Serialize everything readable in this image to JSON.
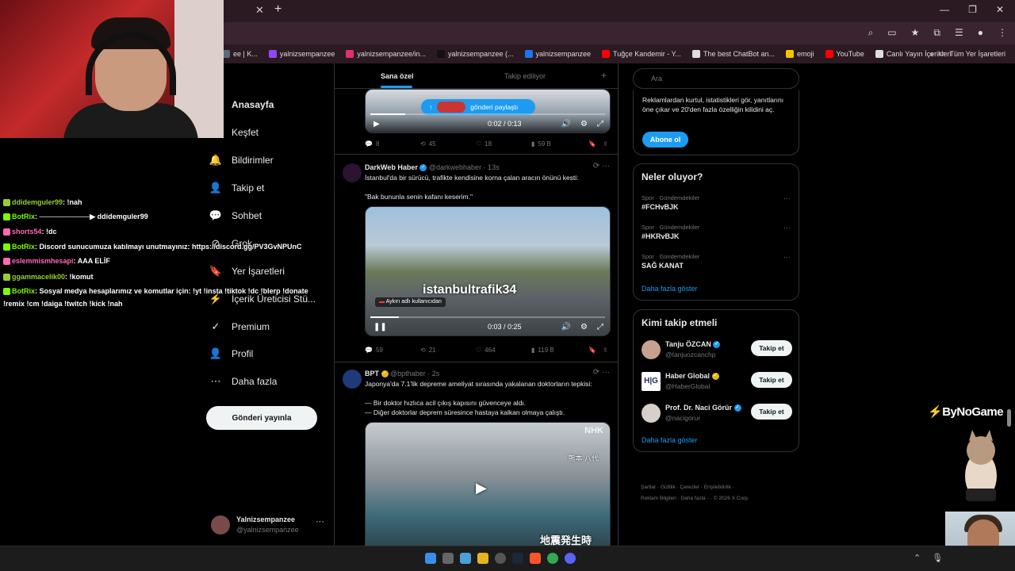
{
  "browser": {
    "bookmarks": [
      {
        "label": "ee | K...",
        "color": "#5a6b7c",
        "icon": "page-icon"
      },
      {
        "label": "yalnizsempanzee",
        "color": "#9147ff",
        "icon": "twitch-icon"
      },
      {
        "label": "yalnizsempanzee/in...",
        "color": "#e1306c",
        "icon": "instagram-icon"
      },
      {
        "label": "yalnizsempanzee (...",
        "color": "#111111",
        "icon": "tiktok-icon"
      },
      {
        "label": "yalnizsempanzee",
        "color": "#1877f2",
        "icon": "facebook-icon"
      },
      {
        "label": "Tuğçe Kandemir - Y...",
        "color": "#ff0000",
        "icon": "youtube-icon"
      },
      {
        "label": "The best ChatBot an...",
        "color": "#dddddd",
        "icon": "chatbot-icon"
      },
      {
        "label": "emoji",
        "color": "#f5c400",
        "icon": "emoji-icon"
      },
      {
        "label": "YouTube",
        "color": "#ff0000",
        "icon": "youtube-icon"
      },
      {
        "label": "Canlı Yayın İçerikleri",
        "color": "#dddddd",
        "icon": "folder-icon"
      }
    ],
    "other_bookmarks": "Tüm Yer İşaretleri"
  },
  "nav": {
    "items": [
      {
        "label": "Anasayfa",
        "icon": "home-icon",
        "glyph": "⌂",
        "bold": true
      },
      {
        "label": "Keşfet",
        "icon": "search-icon",
        "glyph": "⌕"
      },
      {
        "label": "Bildirimler",
        "icon": "bell-icon",
        "glyph": "🔔"
      },
      {
        "label": "Takip et",
        "icon": "person-add-icon",
        "glyph": "👤"
      },
      {
        "label": "Sohbet",
        "icon": "chat-icon",
        "glyph": "💬"
      },
      {
        "label": "Grok",
        "icon": "grok-icon",
        "glyph": "⊘"
      },
      {
        "label": "Yer İşaretleri",
        "icon": "bookmark-icon",
        "glyph": "🔖"
      },
      {
        "label": "İçerik Üreticisi Stü...",
        "icon": "creator-studio-icon",
        "glyph": "⚡"
      },
      {
        "label": "Premium",
        "icon": "premium-icon",
        "glyph": "✓"
      },
      {
        "label": "Profil",
        "icon": "profile-icon",
        "glyph": "👤"
      },
      {
        "label": "Daha fazla",
        "icon": "more-icon",
        "glyph": "⋯"
      }
    ],
    "post_button": "Gönderi yayınla",
    "me": {
      "name": "Yalnizsempanzee",
      "handle": "@yalnizsempanzee",
      "more": "···"
    }
  },
  "timeline": {
    "tabs": {
      "active": "Sana özel",
      "inactive": "Takip ediliyor",
      "plus": "+"
    },
    "share_pill": "gönderi paylaştı",
    "tweets": [
      {
        "video_time": "0:02 / 0:13",
        "stats": {
          "replies": "8",
          "reposts": "45",
          "likes": "18",
          "views": "59 B"
        }
      },
      {
        "name": "DarkWeb Haber",
        "handle": "@darkwebhaber · 13s",
        "text": "İstanbul'da bir sürücü, trafikte kendisine korna çalan aracın önünü kesti:\n\n\"Bak bununla senin kafanı keserim.\"",
        "video_caption": "istanbultrafik34",
        "video_badge": "Aykırı adlı kullanıcıdan",
        "video_time": "0:03 / 0:25",
        "stats": {
          "replies": "59",
          "reposts": "21",
          "likes": "464",
          "views": "119 B"
        }
      },
      {
        "name": "BPT",
        "handle": "@bpthaber · 2s",
        "text": "Japonya'da 7.1'lik depreme ameliyat sırasında yakalanan doktorların tepkisi:\n\n— Bir doktor hızlıca acil çıkış kapısını güvenceye aldı.\n— Diğer doktorlar deprem süresince hastaya kalkan olmaya çalıştı.",
        "video_watermark": "NHK",
        "video_label": "熊本 八代",
        "video_caption": "地震発生時"
      }
    ]
  },
  "right": {
    "search_placeholder": "Ara",
    "premium_text": "Reklamlardan kurtul, istatistikleri gör, yanıtlarını öne çıkar ve 20'den fazla özelliğin kilidini aç.",
    "premium_button": "Abone ol",
    "trends_title": "Neler oluyor?",
    "trends": [
      {
        "category": "Spor · Gündemdekiler",
        "name": "#FCHvBJK"
      },
      {
        "category": "Spor · Gündemdekiler",
        "name": "#HKRvBJK"
      },
      {
        "category": "Spor · Gündemdekiler",
        "name": "SAĞ KANAT"
      }
    ],
    "show_more": "Daha fazla göster",
    "who_title": "Kimi takip etmeli",
    "who": [
      {
        "name": "Tanju ÖZCAN",
        "handle": "@tanjuozcanchp",
        "verified": "blue",
        "button": "Takip et",
        "color": "#c8a090"
      },
      {
        "name": "Haber Global",
        "handle": "@HaberGlobal",
        "verified": "gold",
        "button": "Takip et",
        "color": "#ffffff"
      },
      {
        "name": "Prof. Dr. Naci Görür",
        "handle": "@nacigorur",
        "verified": "blue",
        "button": "Takip et",
        "color": "#d8d0c8"
      }
    ],
    "who_more": "Daha fazla göster",
    "footer": [
      "Şartlar",
      "Gizlilik",
      "Çerezler",
      "Erişilebilirlik",
      "Reklam Bilgileri",
      "Daha fazla ···",
      "© 2026 X Corp."
    ]
  },
  "chat": [
    {
      "user": "ddidemguler99",
      "msg": ": !nah",
      "color": "#9acd32"
    },
    {
      "user": "BotRix",
      "msg": ": ──────────▶ ddidemguler99",
      "color": "#7cfc00"
    },
    {
      "user": "shorts54",
      "msg": ": !dc",
      "color": "#ff69b4"
    },
    {
      "user": "BotRix",
      "msg": ": Discord sunucumuza katılmayı unutmayınız: https://discord.gg/PV3GvNPUnC",
      "color": "#7cfc00"
    },
    {
      "user": "eslemmismhesapi",
      "msg": ": AAA ELİF",
      "color": "#ff69b4"
    },
    {
      "user": "ggammacelik00",
      "msg": ": !komut",
      "color": "#9acd32"
    },
    {
      "user": "BotRix",
      "msg": ": Sosyal medya hesaplarımız ve komutlar için: !yt !insta !tiktok !dc !blerp !donate",
      "color": "#7cfc00"
    },
    {
      "user": "",
      "msg": "!remix !cm !daiga !twitch !kick !nah",
      "color": "#ffffff"
    }
  ],
  "overlay": {
    "sponsor": "ByNoGame"
  },
  "colors": {
    "accent": "#1d9bf0",
    "bg": "#000000",
    "border": "#2f3336",
    "muted": "#71767b"
  }
}
